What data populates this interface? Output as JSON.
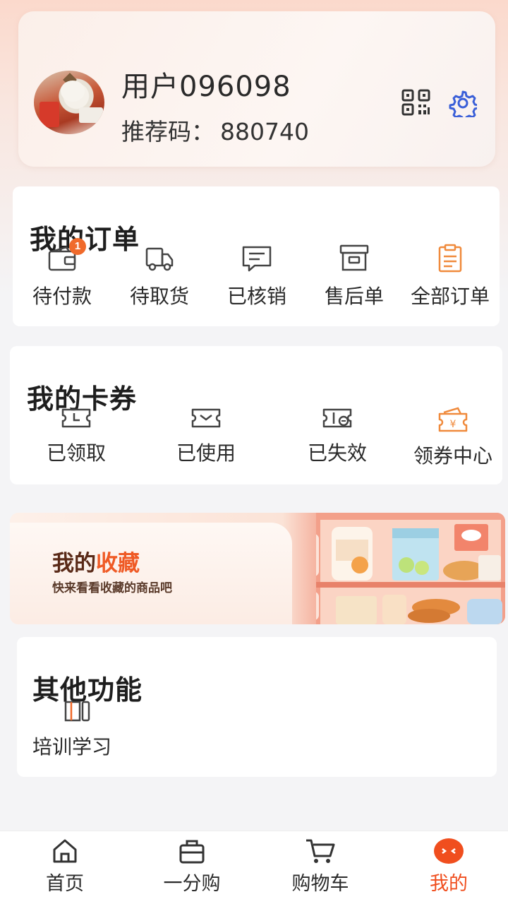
{
  "profile": {
    "username": "用户096098",
    "ref_label": "推荐码：",
    "ref_code": "880740"
  },
  "orders": {
    "title": "我的订单",
    "items": [
      {
        "label": "待付款",
        "icon": "wallet-icon",
        "badge": "1"
      },
      {
        "label": "待取货",
        "icon": "truck-icon"
      },
      {
        "label": "已核销",
        "icon": "message-icon"
      },
      {
        "label": "售后单",
        "icon": "box-icon"
      },
      {
        "label": "全部订单",
        "icon": "clipboard-icon"
      }
    ]
  },
  "coupons": {
    "title": "我的卡券",
    "items": [
      {
        "label": "已领取",
        "icon": "ticket-received-icon"
      },
      {
        "label": "已使用",
        "icon": "ticket-used-icon"
      },
      {
        "label": "已失效",
        "icon": "ticket-expired-icon"
      },
      {
        "label": "领券中心",
        "icon": "coupon-center-icon"
      }
    ]
  },
  "favorites": {
    "title_prefix": "我的",
    "title_accent": "收藏",
    "subtitle": "快来看看收藏的商品吧"
  },
  "other": {
    "title": "其他功能",
    "items": [
      {
        "label": "培训学习",
        "icon": "book-icon"
      }
    ]
  },
  "nav": {
    "items": [
      {
        "label": "首页",
        "icon": "home-icon"
      },
      {
        "label": "一分购",
        "icon": "bag-icon"
      },
      {
        "label": "购物车",
        "icon": "cart-icon"
      },
      {
        "label": "我的",
        "icon": "profile-face-icon",
        "active": true
      }
    ]
  },
  "colors": {
    "accent": "#f04e1e",
    "badge": "#f06a2b",
    "settings": "#3a5fd8"
  }
}
